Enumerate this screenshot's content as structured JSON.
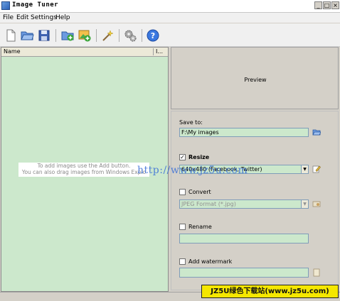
{
  "window": {
    "title": "Image Tuner"
  },
  "menu": [
    "File",
    "Edit",
    "Settings",
    "Help"
  ],
  "toolbar": {
    "buttons": [
      "new-icon",
      "open-folder-icon",
      "save-icon",
      "add-folder-icon",
      "add-image-icon",
      "wand-icon",
      "settings-gears-icon",
      "help-icon"
    ]
  },
  "file_list": {
    "columns": [
      "Name",
      "I..."
    ],
    "hint_line1": "To add images use the Add button.",
    "hint_line2": "You can also drag images from Windows Explo"
  },
  "preview": {
    "label": "Preview"
  },
  "options": {
    "save_to_label": "Save to:",
    "save_to_value": "F:\\My images",
    "resize_label": "Resize",
    "resize_checked": true,
    "resize_value": "640x480 (Facebook, Twitter)",
    "convert_label": "Convert",
    "convert_checked": false,
    "convert_value": "JPEG Format (*.jpg)",
    "rename_label": "Rename",
    "rename_checked": false,
    "rename_value": "",
    "watermark_label": "Add watermark",
    "watermark_checked": false,
    "watermark_value": ""
  },
  "watermarks": {
    "url": "http://www.jz5u.com",
    "badge": "JZ5U绿色下载站(www.jz5u.com)"
  },
  "colors": {
    "list_bg": "#cce8cc",
    "field_bg": "#cce8cc",
    "badge_bg": "#f5e700"
  }
}
